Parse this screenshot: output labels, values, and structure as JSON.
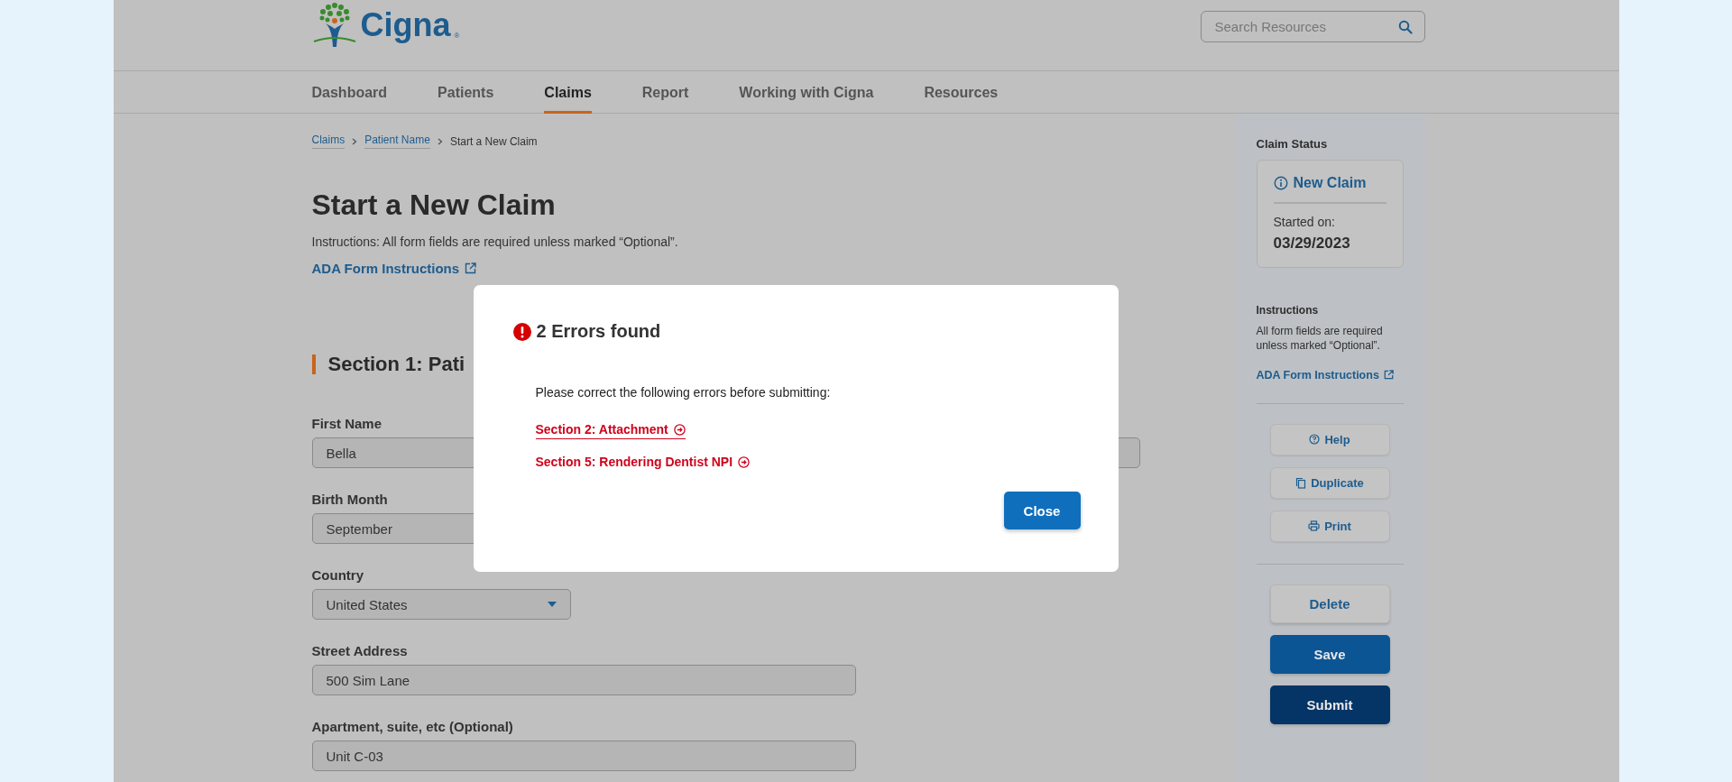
{
  "header": {
    "logo": {
      "name": "Cigna",
      "mark": "®"
    },
    "search": {
      "placeholder": "Search Resources"
    }
  },
  "nav": [
    {
      "label": "Dashboard",
      "selected": false
    },
    {
      "label": "Patients",
      "selected": false
    },
    {
      "label": "Claims",
      "selected": true
    },
    {
      "label": "Report",
      "selected": false
    },
    {
      "label": "Working with Cigna",
      "selected": false
    },
    {
      "label": "Resources",
      "selected": false
    }
  ],
  "breadcrumbs": [
    {
      "label": "Claims",
      "kind": "link"
    },
    {
      "label": "Patient Name",
      "kind": "link"
    },
    {
      "label": "Start a New Claim",
      "kind": "current"
    }
  ],
  "page_title": "Start a New Claim",
  "instructions": "Instructions: All form fields are required unless marked “Optional”.",
  "form_link": "ADA Form Instructions",
  "section_heading": "Section 1: Pati",
  "fields": [
    {
      "label": "First Name",
      "value": "Bella",
      "kind": "text"
    },
    {
      "label": "Birth Month",
      "value": "September",
      "kind": "text"
    },
    {
      "label": "Country",
      "value": "United States",
      "kind": "select"
    },
    {
      "label": "Street Address",
      "value": "500 Sim Lane",
      "kind": "text"
    },
    {
      "label": "Apartment, suite, etc (Optional)",
      "value": "Unit C-03",
      "kind": "text"
    }
  ],
  "sidebar": {
    "status_title": "Claim Status",
    "status": "New Claim",
    "started_label": "Started on:",
    "started_date": "03/29/2023",
    "instructions_title": "Instructions",
    "instructions": "All form fields are required unless marked “Optional”.",
    "form_link": "ADA Form Instructions",
    "tools": [
      {
        "label": "Help"
      },
      {
        "label": "Duplicate"
      },
      {
        "label": "Print"
      }
    ],
    "actions": [
      {
        "label": "Delete",
        "kind": "outline"
      },
      {
        "label": "Save",
        "kind": "primary"
      },
      {
        "label": "Submit",
        "kind": "dark"
      }
    ]
  },
  "dialog": {
    "title": "2 Errors found",
    "message": "Please correct the following errors before submitting:",
    "errors": [
      {
        "label": "Section 2: Attachment",
        "selected": true
      },
      {
        "label": "Section 5: Rendering Dentist NPI",
        "selected": false
      }
    ],
    "button": "Close"
  }
}
